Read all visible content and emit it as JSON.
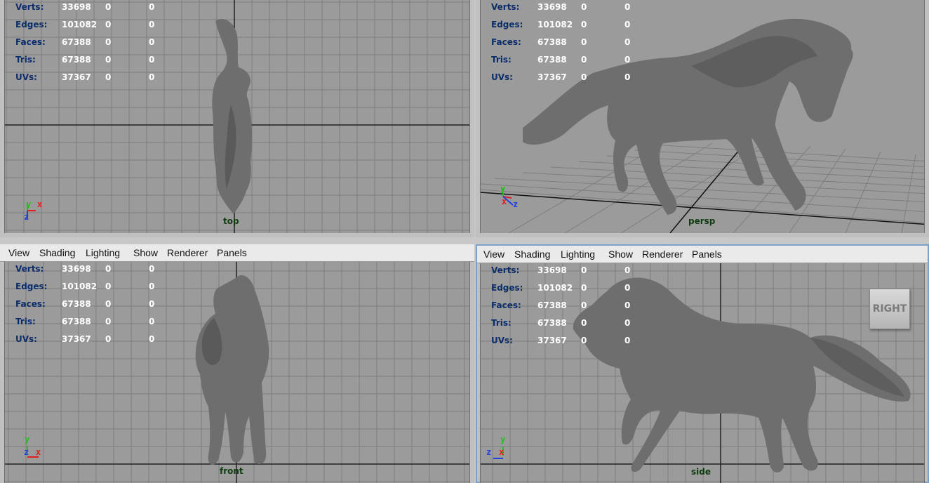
{
  "menu": [
    "View",
    "Shading",
    "Lighting",
    "Show",
    "Renderer",
    "Panels"
  ],
  "hud": {
    "rows": [
      {
        "label": "Verts:",
        "v1": "33698",
        "v2": "0",
        "v3": "0"
      },
      {
        "label": "Edges:",
        "v1": "101082",
        "v2": "0",
        "v3": "0"
      },
      {
        "label": "Faces:",
        "v1": "67388",
        "v2": "0",
        "v3": "0"
      },
      {
        "label": "Tris:",
        "v1": "67388",
        "v2": "0",
        "v3": "0"
      },
      {
        "label": "UVs:",
        "v1": "37367",
        "v2": "0",
        "v3": "0"
      }
    ]
  },
  "viewports": {
    "top": {
      "camera": "top",
      "axes": [
        "y",
        "x",
        "z"
      ]
    },
    "persp": {
      "camera": "persp",
      "axes": [
        "y",
        "x",
        "z"
      ]
    },
    "front": {
      "camera": "front",
      "axes": [
        "y",
        "z",
        "x"
      ]
    },
    "side": {
      "camera": "side",
      "axes": [
        "y",
        "z",
        "x"
      ],
      "viewcube": "RIGHT"
    }
  },
  "colors": {
    "grid_bg": "#9b9b9b",
    "grid_line": "#7e7e7e",
    "axis_line": "#222222",
    "model": "#6e6e6e",
    "hud_label": "#0c2d6b",
    "hud_value": "#ffffff",
    "cam_label": "#0f3d0f",
    "axis_x": "#e02020",
    "axis_y": "#20c020",
    "axis_z": "#2040e0",
    "active_border": "#7da2c9"
  }
}
